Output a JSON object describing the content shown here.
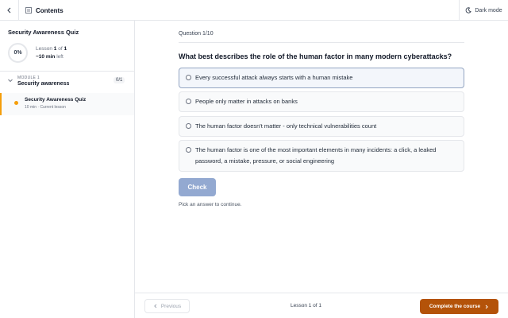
{
  "topbar": {
    "contents_label": "Contents",
    "dark_mode_label": "Dark mode"
  },
  "sidebar": {
    "course_title": "Security Awareness Quiz",
    "progress_percent": "0%",
    "lesson_prefix": "Lesson ",
    "lesson_current": "1",
    "lesson_of": " of ",
    "lesson_total": "1",
    "time_left_value": "~10 min",
    "time_left_suffix": " left",
    "module": {
      "label": "MODULE 1",
      "name": "Security awareness",
      "count": "0/1"
    },
    "lessons": [
      {
        "name": "Security Awareness Quiz",
        "meta": "10 min · Current lesson"
      }
    ]
  },
  "quiz": {
    "counter": "Question 1/10",
    "question": "What best describes the role of the human factor in many modern cyberattacks?",
    "options": [
      {
        "text": "Every successful attack always starts with a human mistake"
      },
      {
        "text": "People only matter in attacks on banks"
      },
      {
        "text": "The human factor doesn't matter - only technical vulnerabilities count"
      },
      {
        "text": "The human factor is one of the most important elements in many incidents: a click, a leaked password, a mistake, pressure, or social engineering"
      }
    ],
    "check_label": "Check",
    "hint": "Pick an answer to continue."
  },
  "footer": {
    "previous_label": "Previous",
    "status": "Lesson 1 of 1",
    "complete_label": "Complete the course"
  },
  "colors": {
    "accent": "#f59e0b",
    "complete_button": "#b45309",
    "check_button": "#93a9d1"
  }
}
